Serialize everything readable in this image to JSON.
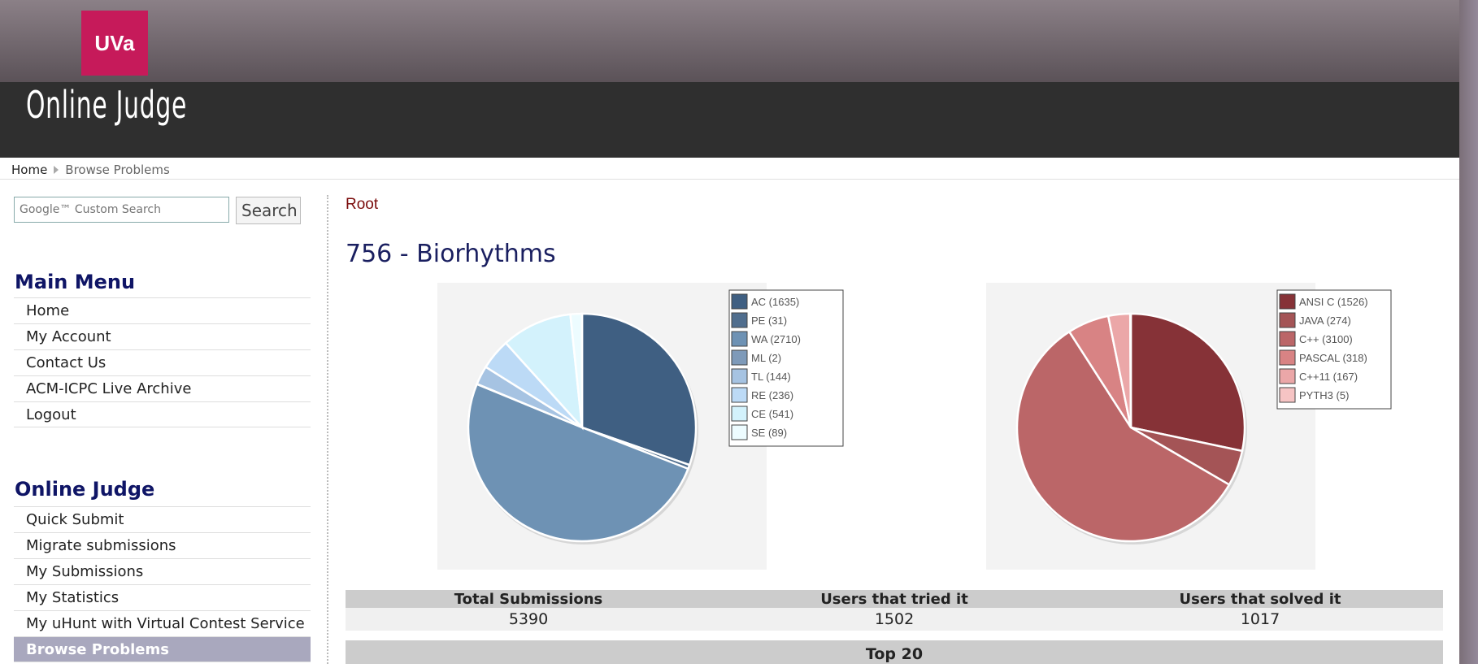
{
  "header": {
    "logo_text": "UVa",
    "site_title": "Online Judge"
  },
  "breadcrumb": {
    "home": "Home",
    "current": "Browse Problems"
  },
  "search": {
    "placeholder": "Google™ Custom Search",
    "button": "Search"
  },
  "main_menu": {
    "title": "Main Menu",
    "items": [
      "Home",
      "My Account",
      "Contact Us",
      "ACM-ICPC Live Archive",
      "Logout"
    ]
  },
  "judge_menu": {
    "title": "Online Judge",
    "items": [
      "Quick Submit",
      "Migrate submissions",
      "My Submissions",
      "My Statistics",
      "My uHunt with Virtual Contest Service",
      "Browse Problems"
    ],
    "active": "Browse Problems"
  },
  "content": {
    "root_link": "Root",
    "problem_title": "756 - Biorhythms"
  },
  "chart_data": [
    {
      "type": "pie",
      "title": "",
      "legend_position": "top-right",
      "labels": [
        "AC (1635)",
        "PE (31)",
        "WA (2710)",
        "ML (2)",
        "TL (144)",
        "RE (236)",
        "CE (541)",
        "SE (89)"
      ],
      "values": [
        1635,
        31,
        2710,
        2,
        144,
        236,
        541,
        89
      ],
      "colors": [
        "#3f5f82",
        "#506e8e",
        "#6e92b4",
        "#7e9ab9",
        "#a6c3e2",
        "#bcdaf6",
        "#d3f2fc",
        "#edfcff"
      ]
    },
    {
      "type": "pie",
      "title": "",
      "legend_position": "top-right",
      "labels": [
        "ANSI C (1526)",
        "JAVA (274)",
        "C++ (3100)",
        "PASCAL (318)",
        "C++11 (167)",
        "PYTH3 (5)"
      ],
      "values": [
        1526,
        274,
        3100,
        318,
        167,
        5
      ],
      "colors": [
        "#863237",
        "#a45456",
        "#bb6668",
        "#d88384",
        "#eba7a8",
        "#f6c4c4"
      ]
    }
  ],
  "stats": {
    "headers": [
      "Total Submissions",
      "Users that tried it",
      "Users that solved it"
    ],
    "values": [
      "5390",
      "1502",
      "1017"
    ]
  },
  "top20": "Top 20"
}
